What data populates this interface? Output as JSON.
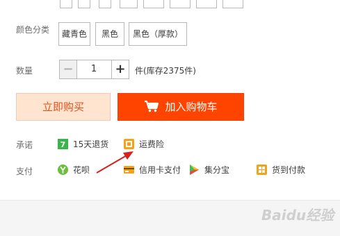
{
  "color": {
    "label": "颜色分类",
    "options": [
      "藏青色",
      "黑色",
      "黑色（厚款）"
    ]
  },
  "quantity": {
    "label": "数量",
    "minus": "−",
    "value": "1",
    "plus": "+",
    "stock": "件(库存2375件)"
  },
  "actions": {
    "buy_now": "立即购买",
    "add_to_cart": "加入购物车"
  },
  "promise": {
    "label": "承诺",
    "items": [
      "15天退货",
      "运费险"
    ]
  },
  "payment": {
    "label": "支付",
    "items": [
      "花呗",
      "信用卡支付",
      "集分宝",
      "货到付款"
    ]
  },
  "watermark": "Baidu经验",
  "colors": {
    "accent": "#ff4400",
    "buy_bg": "#ffe4d0",
    "buy_text": "#e5511d",
    "arrow": "#d9201c"
  }
}
